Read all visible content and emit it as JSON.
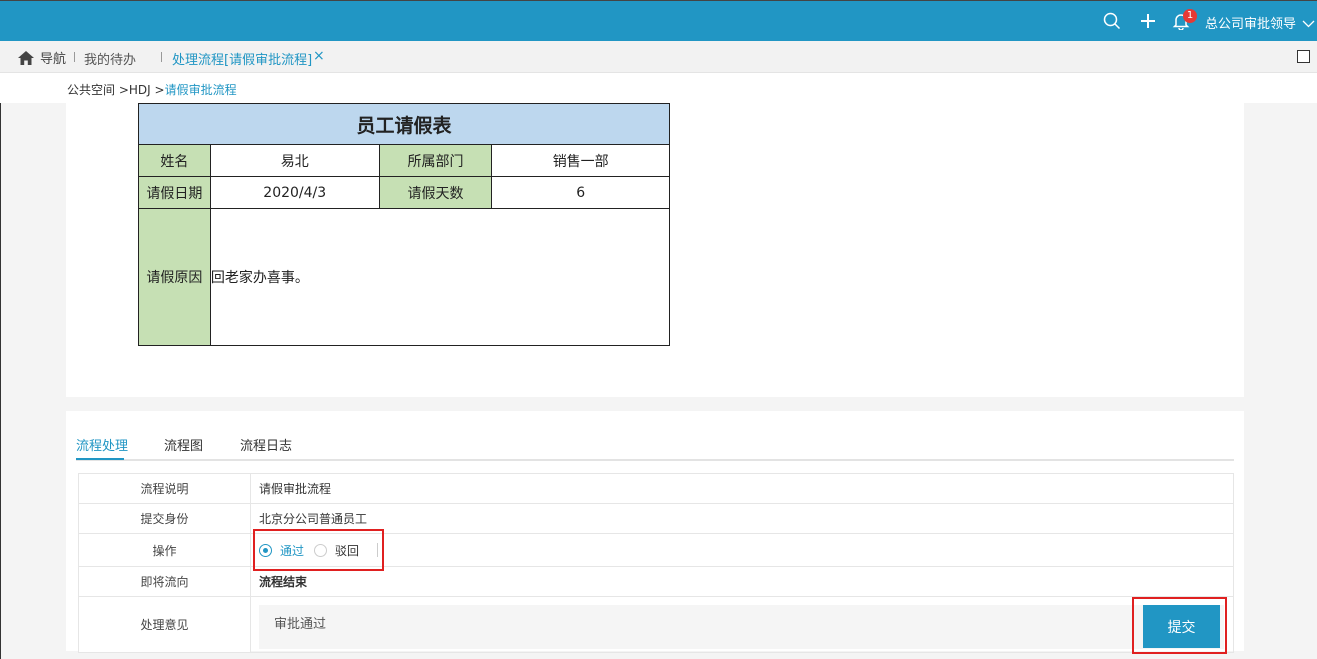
{
  "topbar": {
    "notification_count": "1",
    "user_name": "总公司审批领导",
    "accent": "#2196c4"
  },
  "tabs": {
    "nav_label": "导航",
    "items": [
      {
        "label": "我的待办"
      },
      {
        "label": "处理流程[请假审批流程]"
      }
    ],
    "close_glyph": "×"
  },
  "breadcrumb": {
    "root": "公共空间",
    "sep1": " >",
    "mid": "HDJ",
    "sep2": " >",
    "current": "请假审批流程"
  },
  "form": {
    "title": "员工请假表",
    "name_label": "姓名",
    "name_value": "易北",
    "dept_label": "所属部门",
    "dept_value": "销售一部",
    "date_label": "请假日期",
    "date_value": "2020/4/3",
    "days_label": "请假天数",
    "days_value": "6",
    "reason_label": "请假原因",
    "reason_value": "回老家办喜事。"
  },
  "process": {
    "tabs": [
      {
        "label": "流程处理"
      },
      {
        "label": "流程图"
      },
      {
        "label": "流程日志"
      }
    ],
    "rows": {
      "desc_label": "流程说明",
      "desc_value": "请假审批流程",
      "identity_label": "提交身份",
      "identity_value": "北京分公司普通员工",
      "op_label": "操作",
      "op_pass": "通过",
      "op_reject": "驳回",
      "next_label": "即将流向",
      "next_value": "流程结束",
      "opinion_label": "处理意见",
      "opinion_value": "审批通过"
    },
    "submit_label": "提交"
  }
}
